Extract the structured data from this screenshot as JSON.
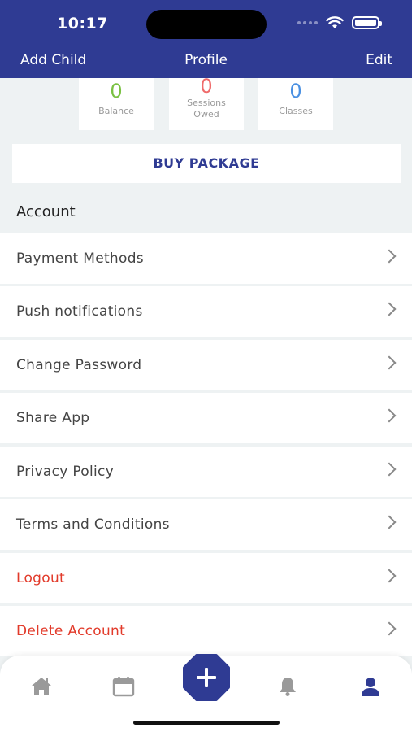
{
  "status_bar": {
    "time": "10:17"
  },
  "nav": {
    "left": "Add Child",
    "title": "Profile",
    "right": "Edit"
  },
  "stats": [
    {
      "value": "0",
      "label": "Balance",
      "color": "#7ac143"
    },
    {
      "value": "0",
      "label": "Sessions Owed",
      "color": "#ef6b6b"
    },
    {
      "value": "0",
      "label": "Classes",
      "color": "#4a90e2"
    }
  ],
  "buy_button": "BUY PACKAGE",
  "section_title": "Account",
  "menu": [
    {
      "label": "Payment Methods"
    },
    {
      "label": "Push notifications"
    },
    {
      "label": "Change Password"
    },
    {
      "label": "Share App"
    },
    {
      "label": "Privacy Policy"
    },
    {
      "label": "Terms and Conditions"
    },
    {
      "label": "Logout"
    },
    {
      "label": "Delete Account"
    }
  ],
  "tabbar": {
    "icons": [
      "home-icon",
      "calendar-icon",
      "plus-icon",
      "bell-icon",
      "profile-icon"
    ],
    "active": "profile-icon"
  },
  "colors": {
    "brand": "#2f3b93",
    "danger": "#e23a2a",
    "inactive_icon": "#9a9a9a"
  }
}
